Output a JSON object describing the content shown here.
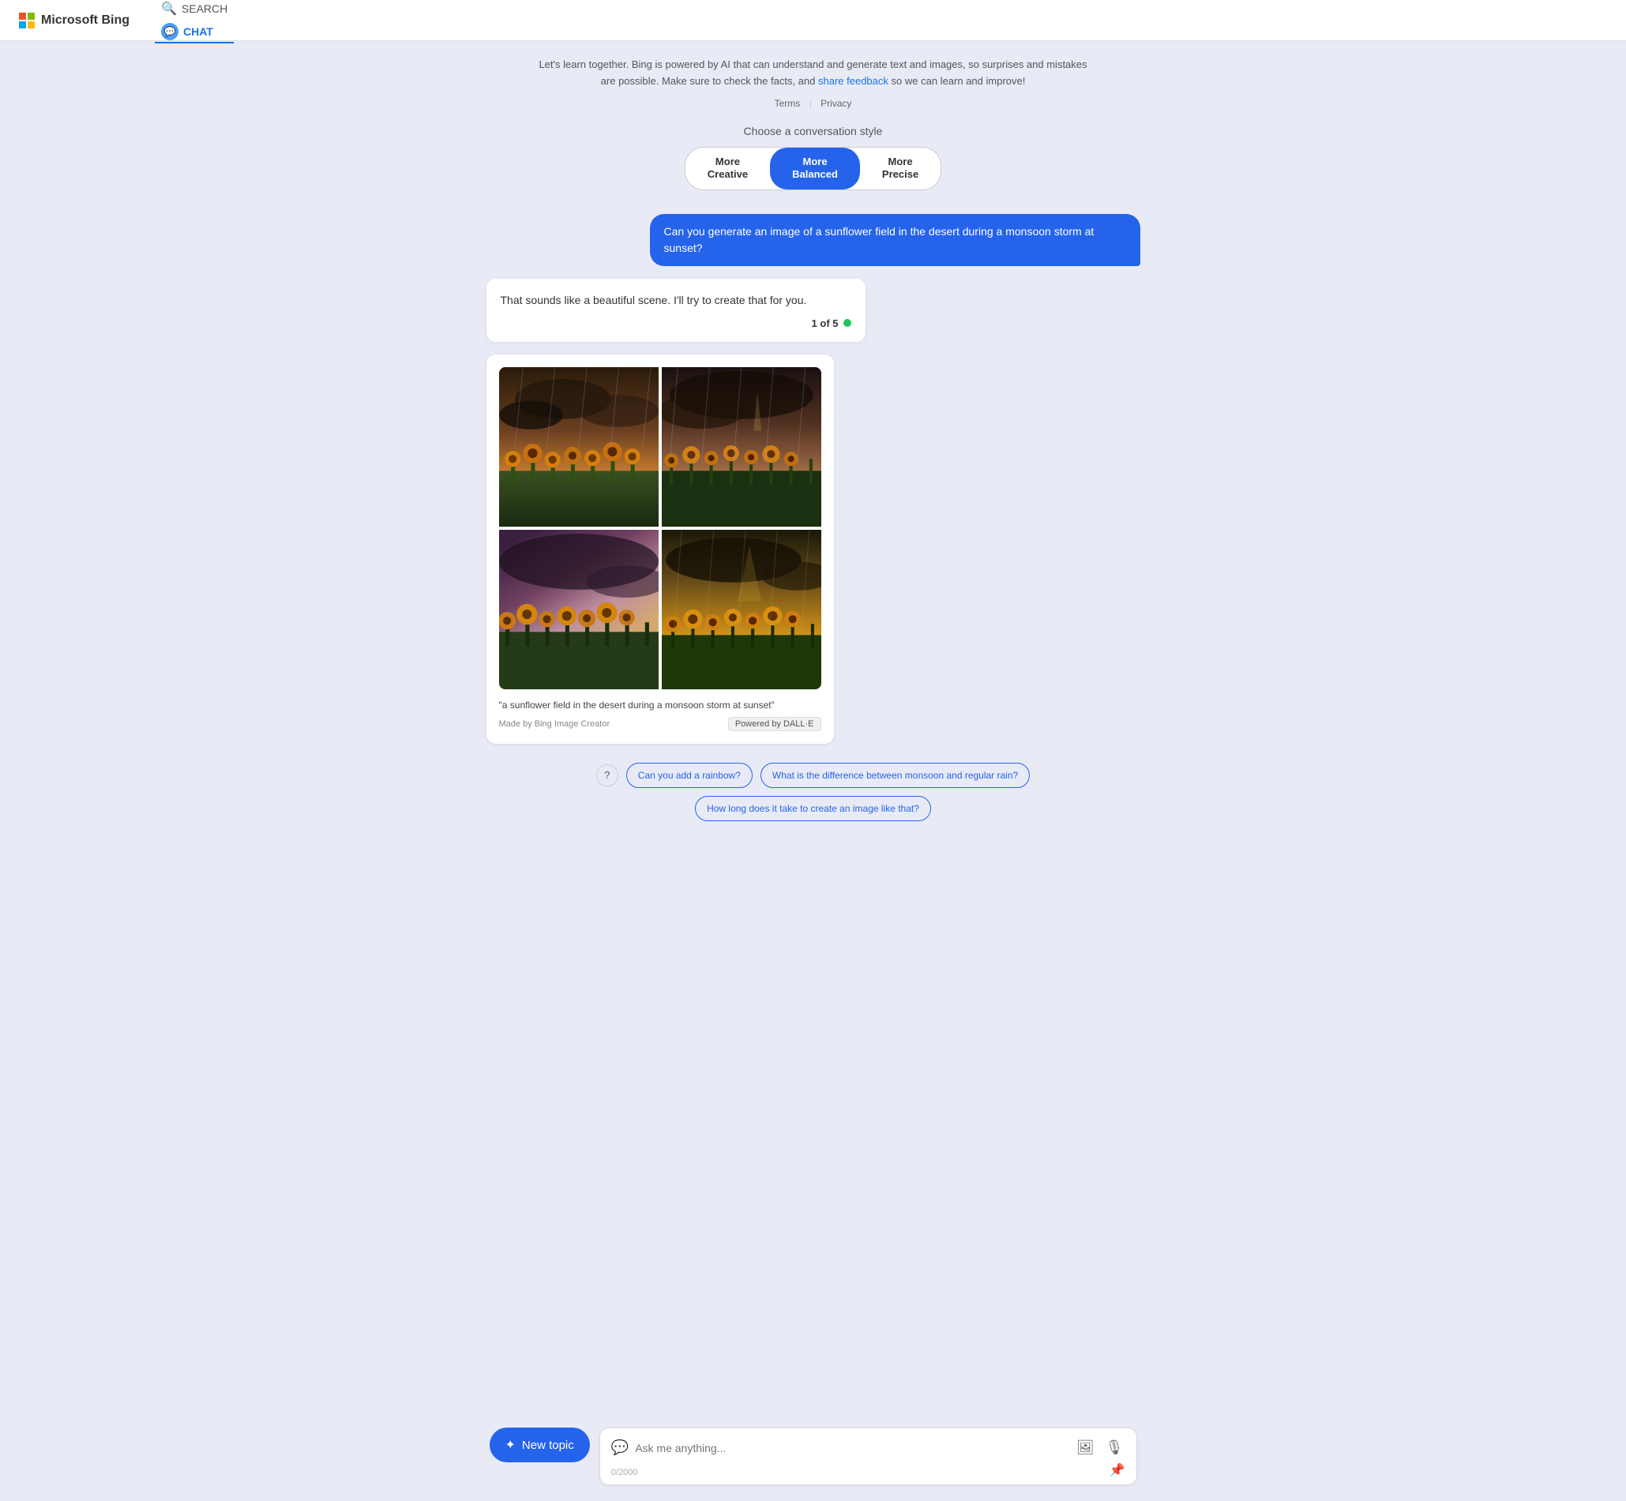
{
  "header": {
    "brand": "Microsoft Bing",
    "nav_search": "SEARCH",
    "nav_chat": "CHAT",
    "search_icon": "🔍",
    "chat_icon": "💬"
  },
  "disclaimer": {
    "text1": "Let's learn together. Bing is powered by AI that can understand and generate text and images, so surprises and mistakes are",
    "text2": "possible. Make sure to check the facts, and",
    "link_text": "share feedback",
    "text3": "so we can learn and improve!",
    "terms": "Terms",
    "privacy": "Privacy"
  },
  "conversation_style": {
    "label": "Choose a conversation style",
    "options": [
      {
        "id": "creative",
        "top": "More",
        "bottom": "Creative",
        "active": false
      },
      {
        "id": "balanced",
        "top": "More",
        "bottom": "Balanced",
        "active": true
      },
      {
        "id": "precise",
        "top": "More",
        "bottom": "Precise",
        "active": false
      }
    ]
  },
  "messages": {
    "user_message": "Can you generate an image of a sunflower field in the desert during a monsoon storm at sunset?",
    "ai_text": "That sounds like a beautiful scene. I'll try to create that for you.",
    "counter": "1 of 5",
    "image_caption": "\"a sunflower field in the desert during a monsoon storm at sunset\"",
    "made_by": "Made by Bing Image Creator",
    "dalle_badge": "Powered by DALL·E"
  },
  "suggestions": {
    "chips": [
      "Can you add a rainbow?",
      "What is the difference between monsoon and regular rain?",
      "How long does it take to create an image like that?"
    ]
  },
  "bottom": {
    "new_topic": "New topic",
    "input_placeholder": "Ask me anything...",
    "char_count": "0/2000"
  }
}
